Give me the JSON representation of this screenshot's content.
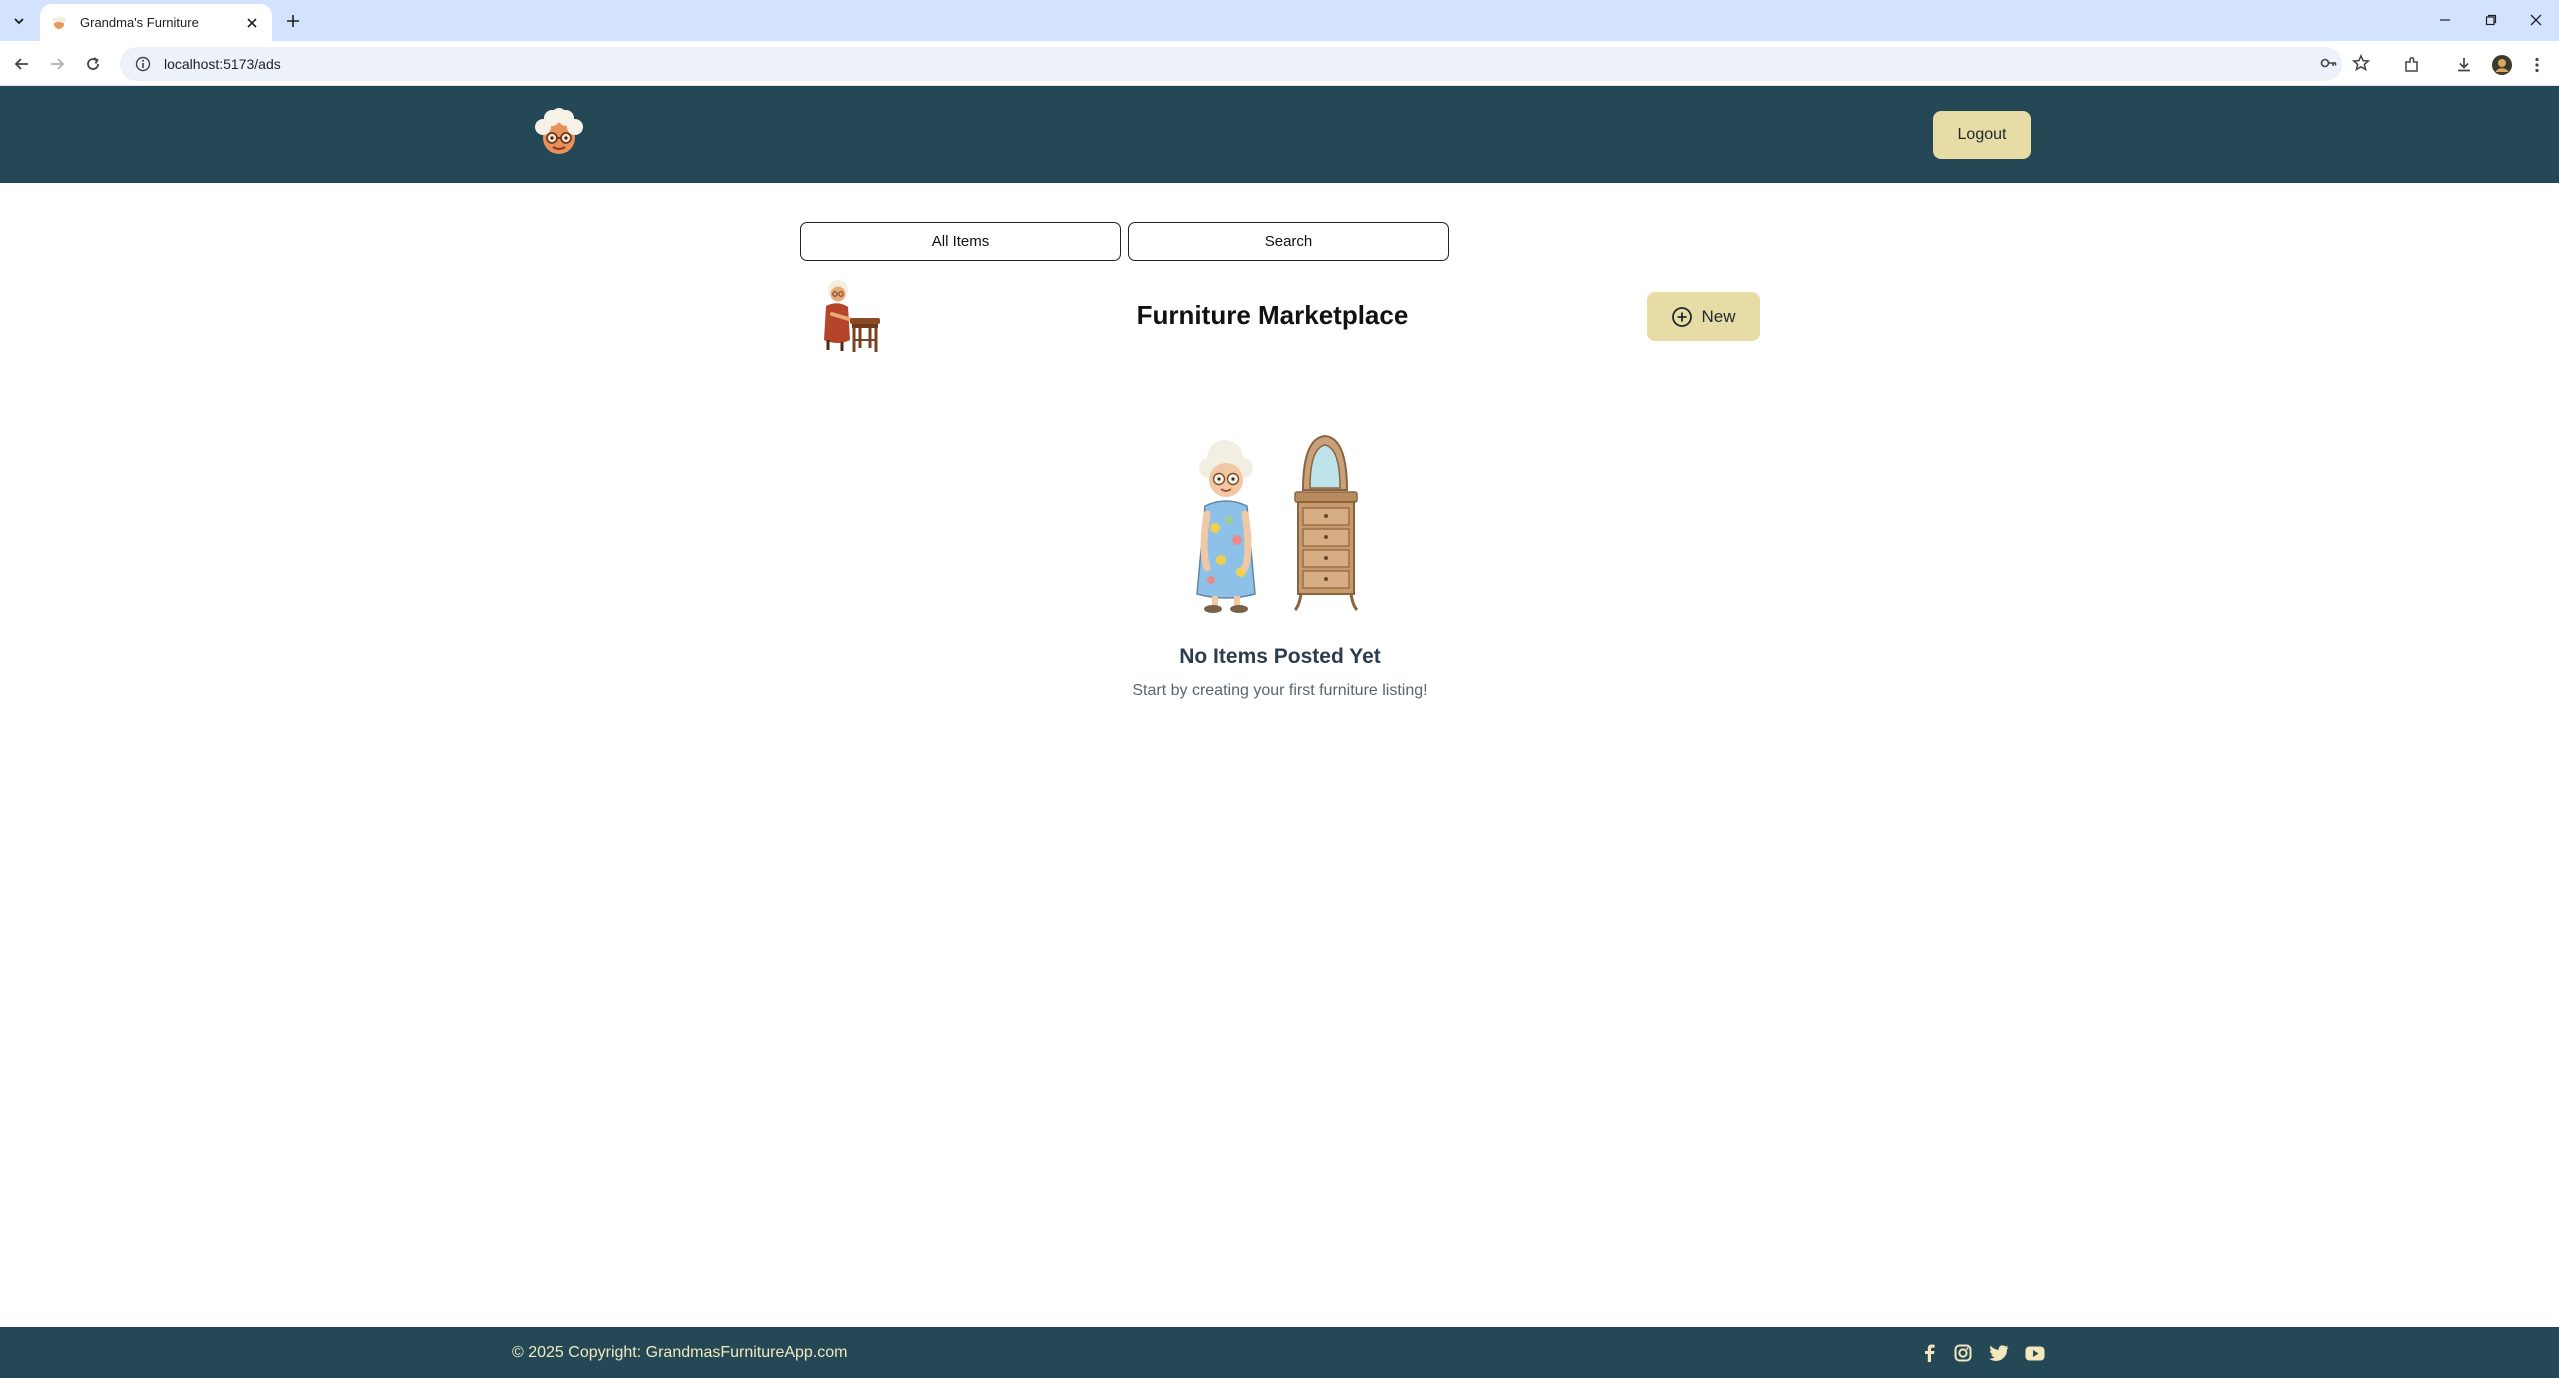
{
  "browser": {
    "tab_title": "Grandma's Furniture",
    "url": "localhost:5173/ads",
    "icons": [
      "tab-list-icon",
      "close-icon",
      "plus-icon",
      "minimize-icon",
      "restore-icon",
      "window-close-icon",
      "back-icon",
      "forward-icon",
      "reload-icon",
      "site-info-icon",
      "password-key-icon",
      "bookmark-star-icon",
      "extensions-icon",
      "download-icon",
      "profile-avatar",
      "more-menu-icon"
    ]
  },
  "header": {
    "logout_label": "Logout",
    "colors": {
      "bar": "#244855",
      "button": "#e8dca6"
    }
  },
  "filters": {
    "all_items_label": "All Items",
    "search_label": "Search"
  },
  "marketplace": {
    "title": "Furniture Marketplace",
    "new_label": "New"
  },
  "empty_state": {
    "title": "No Items Posted Yet",
    "subtitle": "Start by creating your first furniture listing!"
  },
  "footer": {
    "copyright": "© 2025 Copyright: GrandmasFurnitureApp.com",
    "social": [
      "facebook-icon",
      "instagram-icon",
      "twitter-icon",
      "youtube-icon"
    ],
    "text_color": "#f3e8bd"
  }
}
